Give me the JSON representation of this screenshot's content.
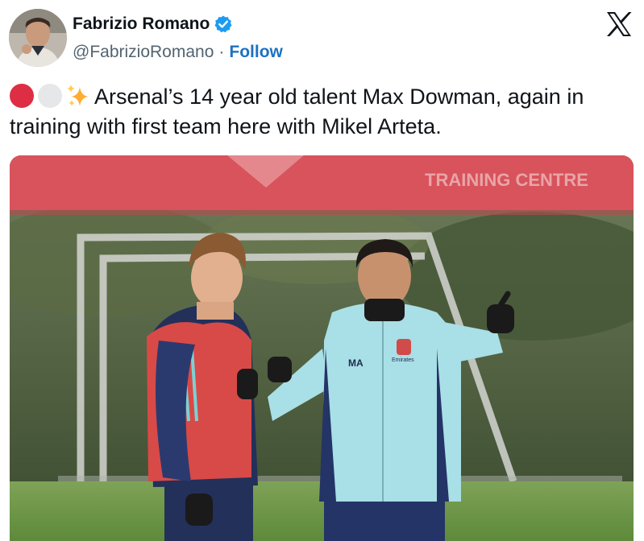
{
  "author": {
    "display_name": "Fabrizio Romano",
    "handle": "@FabrizioRomano",
    "separator": "·",
    "follow_label": "Follow",
    "verified_color": "#1d9bf0",
    "avatar_icon": "profile-photo"
  },
  "platform": {
    "logo_icon": "x-logo-icon"
  },
  "tweet": {
    "text": "Arsenal’s 14 year old talent Max Dowman, again in training with first team here with Mikel Arteta.",
    "emojis": [
      "red-circle",
      "white-circle",
      "sparkles"
    ]
  },
  "photo": {
    "banner_text": "TRAINING CENTRE",
    "jacket_initials": "MA",
    "sponsor_text": "Emirates",
    "subject": "Arsenal youth player and Mikel Arteta at training ground"
  },
  "colors": {
    "link": "#1d72c2",
    "text": "#0f1419",
    "secondary": "#536471",
    "banner": "#d8535b"
  }
}
